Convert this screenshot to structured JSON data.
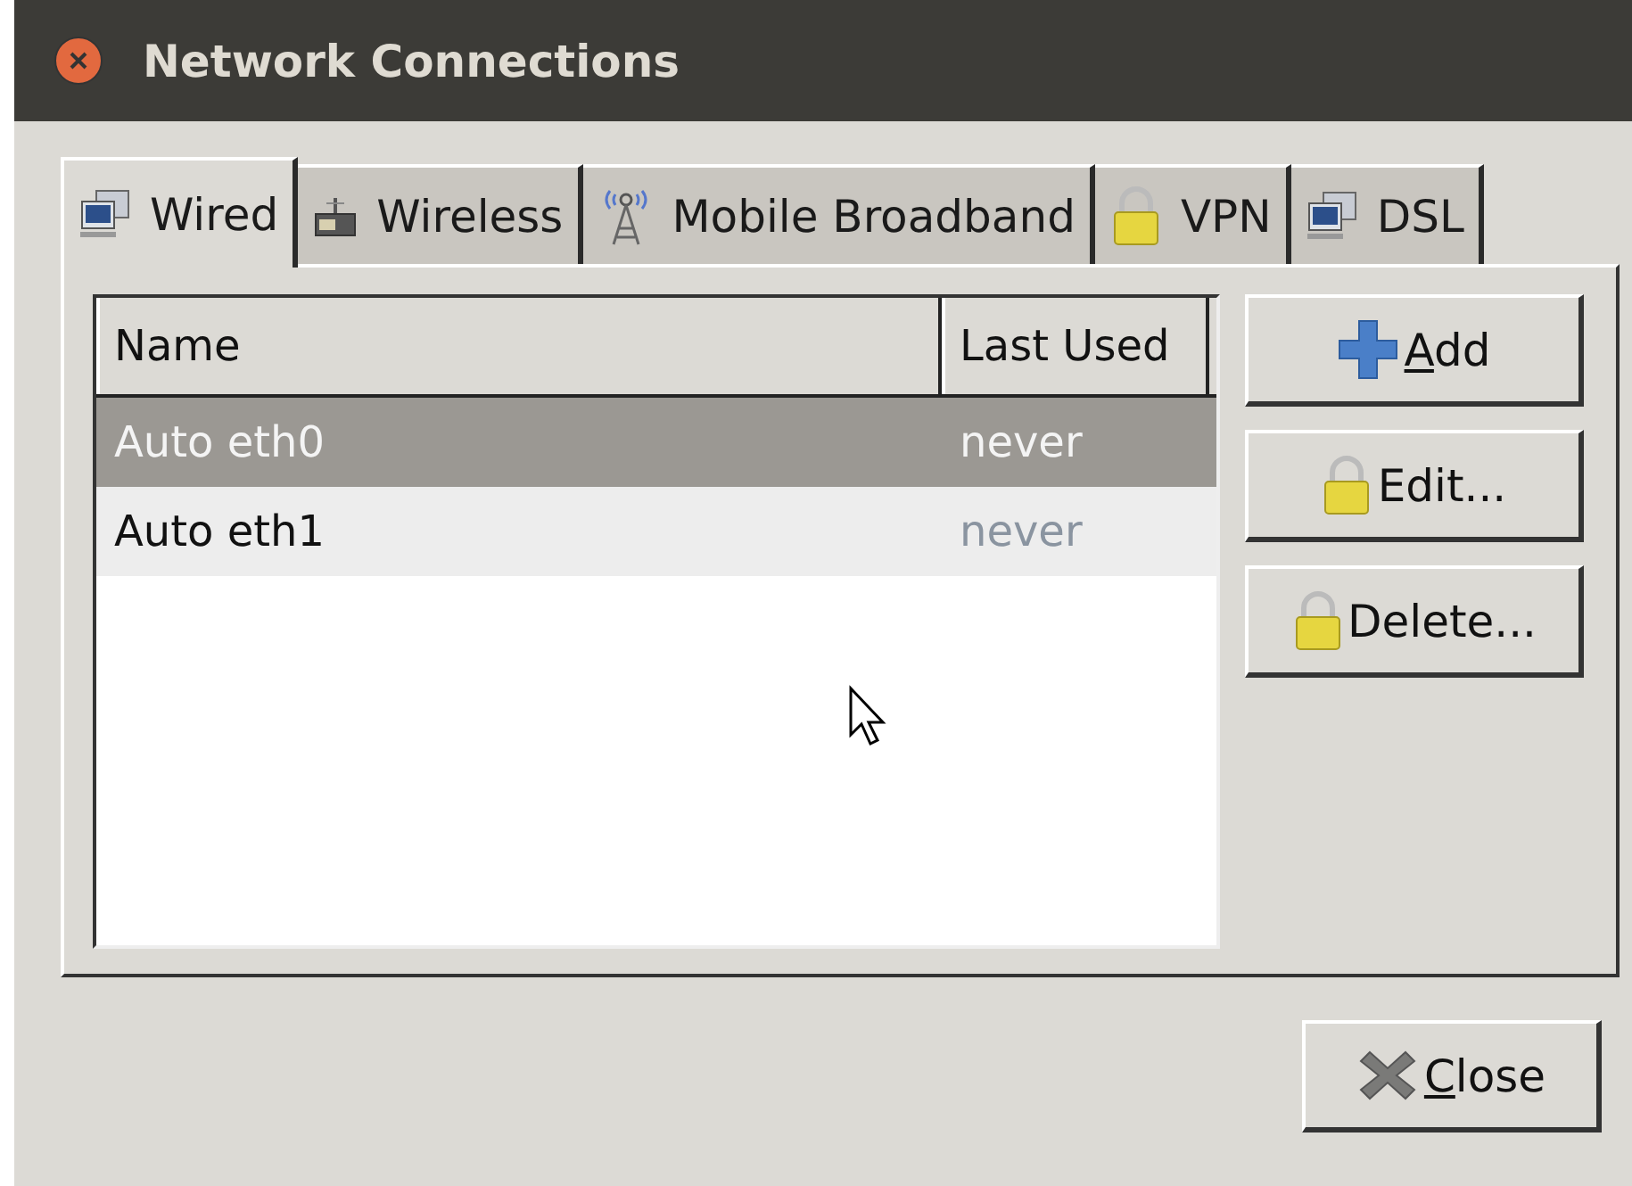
{
  "window": {
    "title": "Network Connections"
  },
  "tabs": [
    {
      "label": "Wired",
      "kind": "computer",
      "selected": true
    },
    {
      "label": "Wireless",
      "kind": "router",
      "selected": false
    },
    {
      "label": "Mobile Broadband",
      "kind": "antenna",
      "selected": false
    },
    {
      "label": "VPN",
      "kind": "lock",
      "selected": false
    },
    {
      "label": "DSL",
      "kind": "computer",
      "selected": false
    }
  ],
  "table": {
    "columns": [
      "Name",
      "Last Used"
    ],
    "rows": [
      {
        "name": "Auto eth0",
        "last_used": "never",
        "selected": true
      },
      {
        "name": "Auto eth1",
        "last_used": "never",
        "selected": false
      }
    ]
  },
  "buttons": [
    {
      "label": "Add",
      "kind": "plus",
      "mnemonic_underlined": true
    },
    {
      "label": "Edit...",
      "kind": "lock",
      "mnemonic_underlined": false
    },
    {
      "label": "Delete...",
      "kind": "lock",
      "mnemonic_underlined": false
    }
  ],
  "close_button": {
    "label": "Close",
    "mnemonic_underlined": true
  }
}
